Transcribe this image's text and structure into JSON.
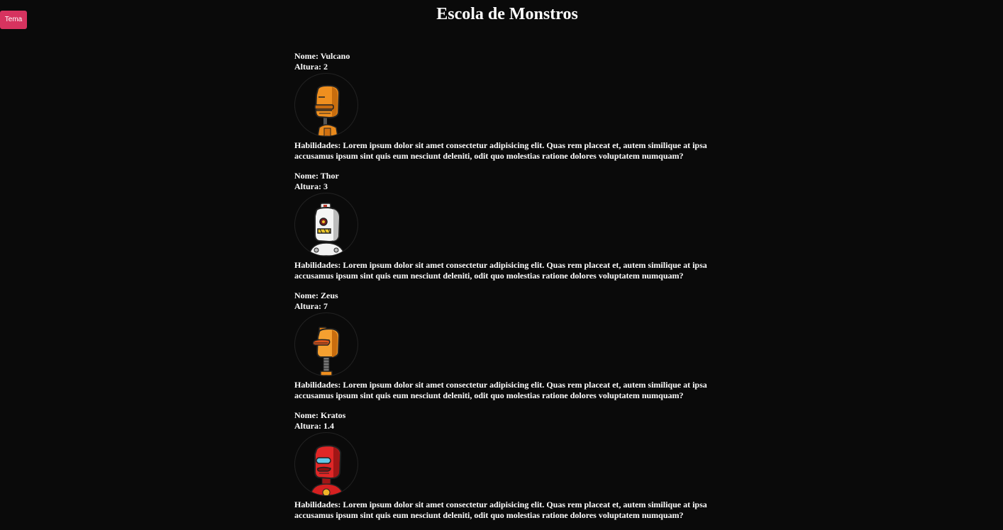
{
  "header": {
    "theme_button_label": "Tema",
    "title": "Escola de Monstros"
  },
  "monsters": [
    {
      "name_label": "Nome: Vulcano",
      "height_label": "Altura: 2",
      "skills_label": "Habilidades: Lorem ipsum dolor sit amet consectetur adipisicing elit. Quas rem placeat et, autem similique at ipsa accusamus ipsum sint quis eum nesciunt deleniti, odit quo molestias ratione dolores voluptatem numquam?",
      "avatar_icon": "orange-robot-icon"
    },
    {
      "name_label": "Nome: Thor",
      "height_label": "Altura: 3",
      "skills_label": "Habilidades: Lorem ipsum dolor sit amet consectetur adipisicing elit. Quas rem placeat et, autem similique at ipsa accusamus ipsum sint quis eum nesciunt deleniti, odit quo molestias ratione dolores voluptatem numquam?",
      "avatar_icon": "white-robot-icon"
    },
    {
      "name_label": "Nome: Zeus",
      "height_label": "Altura: 7",
      "skills_label": "Habilidades: Lorem ipsum dolor sit amet consectetur adipisicing elit. Quas rem placeat et, autem similique at ipsa accusamus ipsum sint quis eum nesciunt deleniti, odit quo molestias ratione dolores voluptatem numquam?",
      "avatar_icon": "orange-duck-robot-icon"
    },
    {
      "name_label": "Nome: Kratos",
      "height_label": "Altura: 1.4",
      "skills_label": "Habilidades: Lorem ipsum dolor sit amet consectetur adipisicing elit. Quas rem placeat et, autem similique at ipsa accusamus ipsum sint quis eum nesciunt deleniti, odit quo molestias ratione dolores voluptatem numquam?",
      "avatar_icon": "red-robot-icon"
    }
  ]
}
